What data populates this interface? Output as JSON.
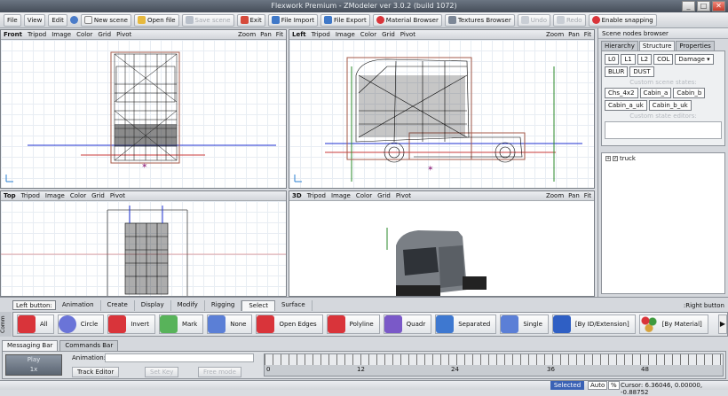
{
  "app": {
    "title": "Flexwork Premium - ZModeler ver 3.0.2 (build 1072)"
  },
  "window_controls": [
    "_",
    "□",
    "✕"
  ],
  "toolbar": {
    "items": [
      {
        "label": "File",
        "icon": ""
      },
      {
        "label": "View",
        "icon": ""
      },
      {
        "label": "Edit",
        "icon": ""
      },
      {
        "label": "New scene",
        "icon": "new-scene-icon"
      },
      {
        "label": "Open file",
        "icon": "open-folder-icon"
      },
      {
        "label": "Save scene",
        "icon": "save-icon",
        "disabled": true
      },
      {
        "label": "Exit",
        "icon": "exit-icon"
      },
      {
        "label": "File Import",
        "icon": "import-icon"
      },
      {
        "label": "File Export",
        "icon": "export-icon"
      },
      {
        "label": "Material Browser",
        "icon": "material-icon"
      },
      {
        "label": "Textures Browser",
        "icon": "texture-icon"
      },
      {
        "label": "Undo",
        "icon": "undo-icon",
        "disabled": true
      },
      {
        "label": "Redo",
        "icon": "redo-icon",
        "disabled": true
      },
      {
        "label": "Enable snapping",
        "icon": "magnet-icon"
      }
    ]
  },
  "viewports": [
    {
      "name": "Front",
      "menus": [
        "Tripod",
        "Image",
        "Color",
        "Grid",
        "Pivot"
      ],
      "tools": [
        "Zoom",
        "Pan",
        "Fit"
      ]
    },
    {
      "name": "Left",
      "menus": [
        "Tripod",
        "Image",
        "Color",
        "Grid",
        "Pivot"
      ],
      "tools": [
        "Zoom",
        "Pan",
        "Fit"
      ]
    },
    {
      "name": "Top",
      "menus": [
        "Tripod",
        "Image",
        "Color",
        "Grid",
        "Pivot"
      ],
      "tools": [
        "Zoom",
        "Pan",
        "Fit"
      ]
    },
    {
      "name": "3D",
      "menus": [
        "Tripod",
        "Image",
        "Color",
        "Grid",
        "Pivot"
      ],
      "tools": [
        "Zoom",
        "Pan",
        "Fit"
      ]
    }
  ],
  "scene_panel": {
    "title": "Scene nodes browser",
    "tabs": [
      "Hierarchy",
      "Structure",
      "Properties"
    ],
    "active_tab": "Structure",
    "lod_chips": [
      "L0",
      "L1",
      "L2",
      "COL",
      "Damage"
    ],
    "lod_chips2": [
      "BLUR",
      "DUST"
    ],
    "custom_states_label": "Custom scene states:",
    "state_chips": [
      "Chs_4x2",
      "Cabin_a",
      "Cabin_b",
      "Cabin_a_uk",
      "Cabin_b_uk"
    ],
    "edit_label": "Custom state editors:",
    "tree": [
      {
        "label": "truck"
      }
    ]
  },
  "bottom": {
    "left_button": "Left button:",
    "right_button": ":Right button",
    "tabs": [
      "Animation",
      "Create",
      "Display",
      "Modify",
      "Rigging",
      "Select",
      "Surface"
    ],
    "active_tab": "Select",
    "side_label": "Comm",
    "select_tools": [
      {
        "label": "All",
        "color": "#d9343a"
      },
      {
        "label": "Circle",
        "color": "#6a74d8"
      },
      {
        "label": "Invert",
        "color": "#d9343a"
      },
      {
        "label": "Mark",
        "color": "#58b35a"
      },
      {
        "label": "None",
        "color": "#5b7fd6"
      },
      {
        "label": "Open Edges",
        "color": "#d9343a"
      },
      {
        "label": "Polyline",
        "color": "#d9343a"
      },
      {
        "label": "Quadr",
        "color": "#7a59c8"
      },
      {
        "label": "Separated",
        "color": "#3e78d0"
      },
      {
        "label": "Single",
        "color": "#5b7fd6"
      },
      {
        "label": "[By ID/Extension]",
        "color": "#2f5fc4"
      },
      {
        "label": "[By Material]",
        "color": "#d7a23a"
      }
    ],
    "message_tabs": [
      "Messaging Bar",
      "Commands Bar"
    ],
    "animation": {
      "play_label": "Play",
      "step_label": "1x",
      "field_label": "Animation:",
      "track_editor": "Track Editor",
      "set_key": "Set Key",
      "free_mode": "Free mode",
      "timeline_marks": [
        "0",
        "12",
        "24",
        "36",
        "48"
      ]
    }
  },
  "status": {
    "selected": "Selected",
    "auto": "Auto",
    "percent": "%",
    "cursor": "Cursor: 6.36046, 0.00000, -0.88752"
  }
}
